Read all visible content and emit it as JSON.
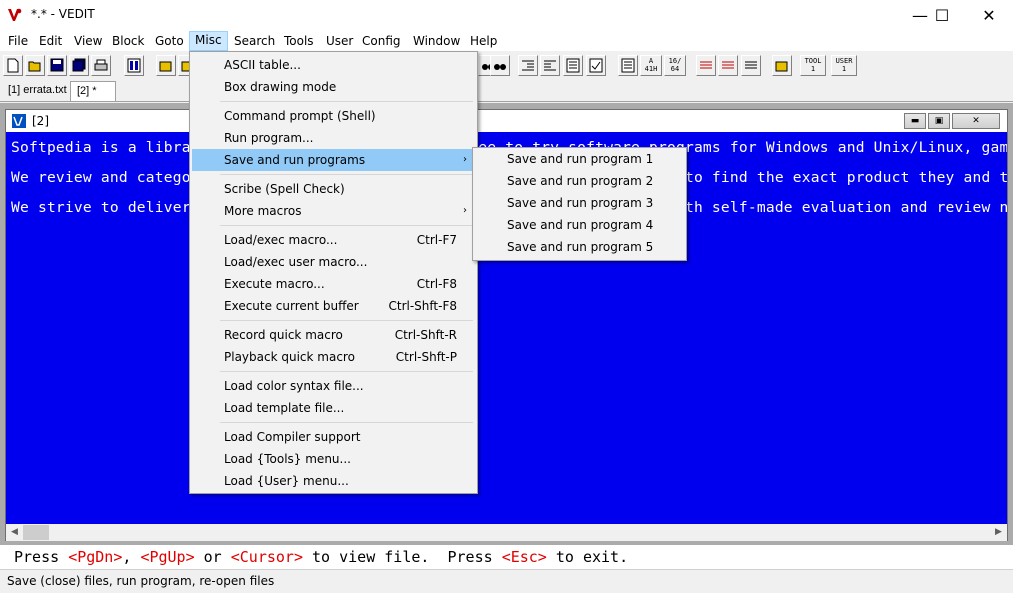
{
  "window": {
    "title": "*.* - VEDIT",
    "minimize": "—",
    "maximize": "☐",
    "close": "✕"
  },
  "menubar": [
    "File",
    "Edit",
    "View",
    "Block",
    "Goto",
    "Misc",
    "Search",
    "Tools",
    "User",
    "Config",
    "Window",
    "Help"
  ],
  "active_menu": "Misc",
  "toolbar": {
    "ascii_top": "A",
    "ascii_bottom": "41H",
    "frac_top": "16/",
    "frac_bottom": "64",
    "tool_top": "TOOL",
    "tool_bottom": "1",
    "user_top": "USER",
    "user_bottom": "1"
  },
  "file_tabs": [
    "[1] errata.txt",
    "[2] *"
  ],
  "document": {
    "title": "[2]",
    "lines": [
      "Softpedia is a library of over 1,300,000 free and free-to-try software programs for Windows and Unix/Linux, gam",
      "We review and categorize these products in order to allow the visitor/user to find the exact product they and t",
      "We strive to deliver only the best products to the visitor/user together with self-made evaluation and review n"
    ]
  },
  "prompt": {
    "parts": [
      "Press ",
      "<PgDn>",
      ", ",
      "<PgUp>",
      " or ",
      "<Cursor>",
      " to view file.  Press ",
      "<Esc>",
      " to exit."
    ]
  },
  "status": "Save (close) files, run program, re-open files",
  "misc_menu": {
    "items": [
      {
        "label": "ASCII table...",
        "accel": ""
      },
      {
        "label": "Box drawing mode",
        "accel": ""
      },
      {
        "label": "Command prompt (Shell)",
        "accel": ""
      },
      {
        "label": "Run program...",
        "accel": ""
      },
      {
        "label": "Save and run programs",
        "accel": "",
        "submenu": true
      },
      {
        "label": "Scribe (Spell Check)",
        "accel": ""
      },
      {
        "label": "More macros",
        "accel": "",
        "submenu": true
      },
      {
        "label": "Load/exec macro...",
        "accel": "Ctrl-F7"
      },
      {
        "label": "Load/exec user macro...",
        "accel": ""
      },
      {
        "label": "Execute macro...",
        "accel": "Ctrl-F8"
      },
      {
        "label": "Execute current buffer",
        "accel": "Ctrl-Shft-F8"
      },
      {
        "label": "Record quick macro",
        "accel": "Ctrl-Shft-R"
      },
      {
        "label": "Playback quick macro",
        "accel": "Ctrl-Shft-P"
      },
      {
        "label": "Load color syntax file...",
        "accel": ""
      },
      {
        "label": "Load template file...",
        "accel": ""
      },
      {
        "label": "Load Compiler support",
        "accel": ""
      },
      {
        "label": "Load {Tools} menu...",
        "accel": ""
      },
      {
        "label": "Load {User} menu...",
        "accel": ""
      }
    ],
    "submenu_arrow": "›"
  },
  "submenu": {
    "items": [
      "Save and run program 1",
      "Save and run program 2",
      "Save and run program 3",
      "Save and run program 4",
      "Save and run program 5"
    ]
  },
  "colors": {
    "editor_bg": "#0000ee",
    "editor_fg": "#ffffff",
    "highlight": "#91c9f7",
    "prompt_key": "#e00000"
  }
}
